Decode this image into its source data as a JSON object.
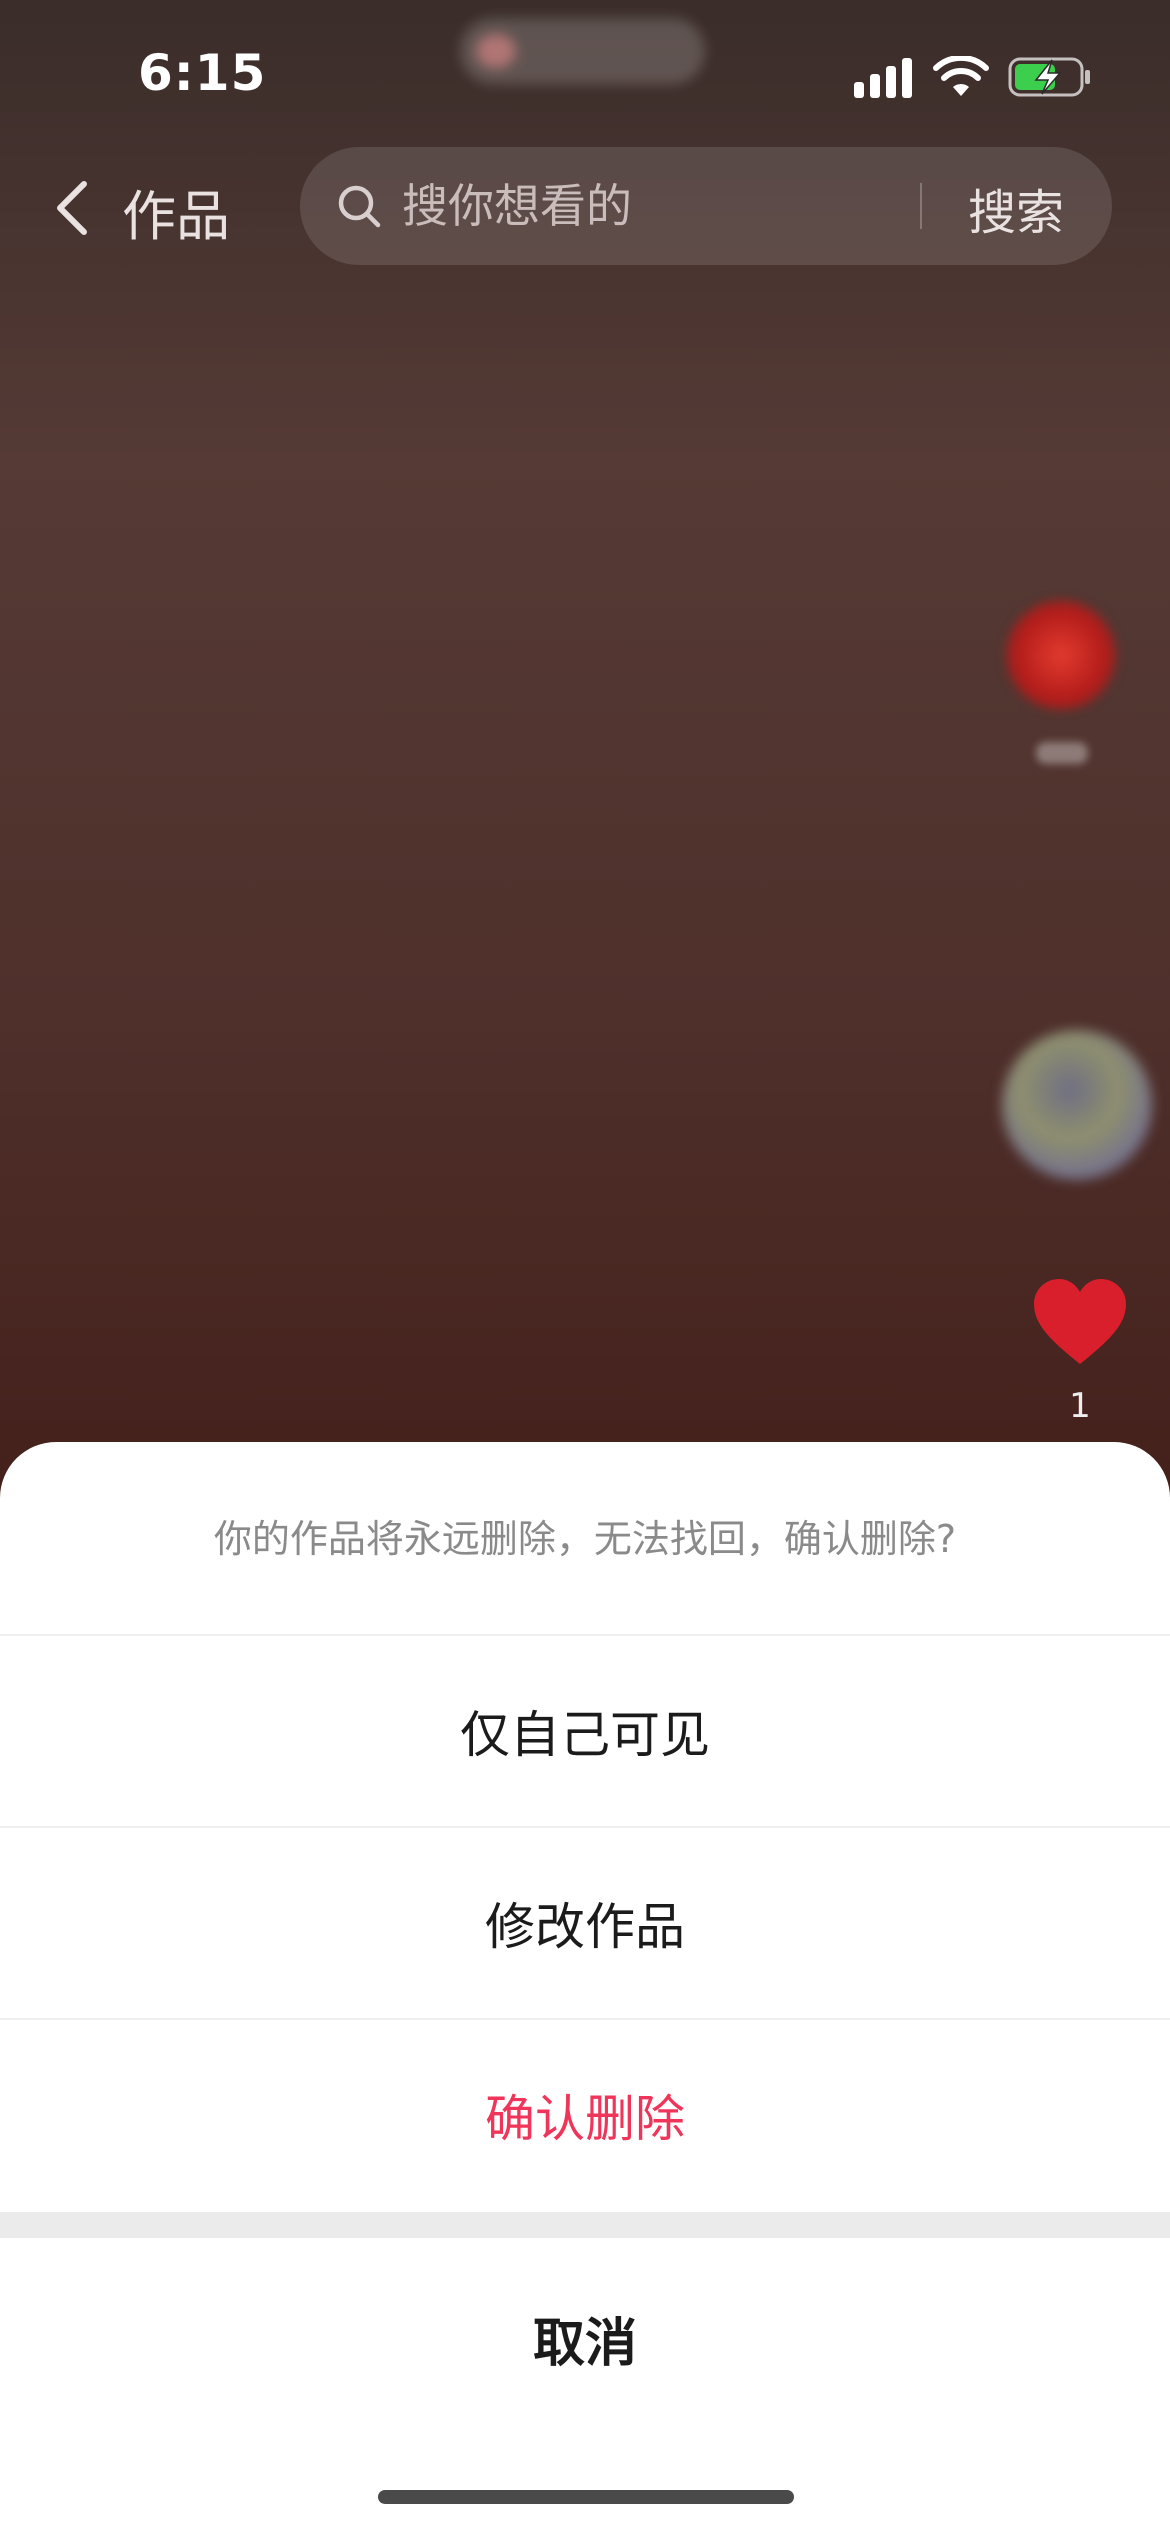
{
  "status_bar": {
    "time": "6:15"
  },
  "header": {
    "back_label": "作品",
    "search_placeholder": "搜你想看的",
    "search_button": "搜索"
  },
  "right_rail": {
    "like_count": "1"
  },
  "action_sheet": {
    "message": "你的作品将永远删除，无法找回，确认删除?",
    "options": [
      {
        "label": "仅自己可见"
      },
      {
        "label": "修改作品"
      },
      {
        "label": "确认删除",
        "color": "#f0355b"
      }
    ],
    "cancel_label": "取消"
  },
  "colors": {
    "danger": "#f0355b",
    "sheet_background": "#ffffff",
    "like": "#d91f2c"
  },
  "icons": [
    "back-chevron-icon",
    "search-icon",
    "signal-icon",
    "wifi-icon",
    "battery-charging-icon",
    "heart-icon"
  ]
}
